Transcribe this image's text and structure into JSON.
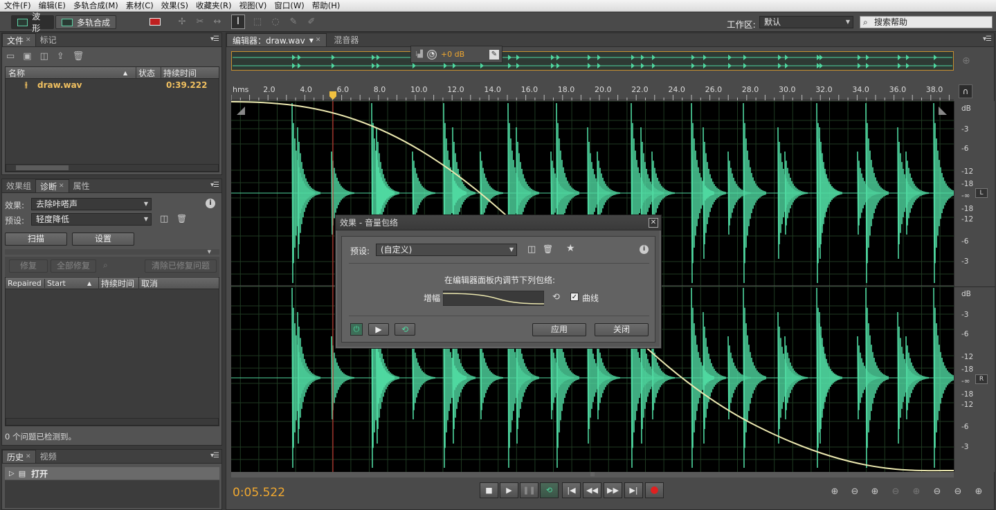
{
  "menu": [
    "文件(F)",
    "编辑(E)",
    "多轨合成(M)",
    "素材(C)",
    "效果(S)",
    "收藏夹(R)",
    "视图(V)",
    "窗口(W)",
    "帮助(H)"
  ],
  "toolbar": {
    "waveform": "波形",
    "multitrack": "多轨合成",
    "workspace_label": "工作区:",
    "workspace_value": "默认",
    "search_placeholder": "搜索帮助"
  },
  "files_panel": {
    "tabs": [
      "文件",
      "标记"
    ],
    "columns": [
      "名称",
      "状态",
      "持续时间"
    ],
    "file": {
      "name": "draw.wav",
      "duration": "0:39.222"
    }
  },
  "diag_panel": {
    "tabs": [
      "效果组",
      "诊断",
      "属性"
    ],
    "effect_label": "效果:",
    "effect_value": "去除咔嗒声",
    "preset_label": "预设:",
    "preset_value": "轻度降低",
    "scan": "扫描",
    "settings": "设置",
    "repair": "修复",
    "repair_all": "全部修复",
    "clear_repaired": "清除已修复问题",
    "columns": [
      "Repaired",
      "Start",
      "持续时间",
      "取消"
    ],
    "status": "0 个问题已检测到。"
  },
  "history_panel": {
    "tabs": [
      "历史",
      "视频"
    ],
    "item": "打开"
  },
  "editor": {
    "tabs": [
      "编辑器：draw.wav",
      "混音器"
    ],
    "hud_gain": "+0 dB",
    "ruler_start": "hms",
    "ruler": [
      "2.0",
      "4.0",
      "6.0",
      "8.0",
      "10.0",
      "12.0",
      "14.0",
      "16.0",
      "18.0",
      "20.0",
      "22.0",
      "24.0",
      "26.0",
      "28.0",
      "30.0",
      "32.0",
      "34.0",
      "36.0",
      "38.0"
    ],
    "db_scale": [
      "dB",
      "-3",
      "-6",
      "-12",
      "-18",
      "-∞",
      "-18",
      "-12",
      "-6",
      "-3"
    ],
    "ch_left": "L",
    "ch_right": "R",
    "time": "0:05.522"
  },
  "dialog": {
    "title": "效果 - 音量包络",
    "preset_label": "预设:",
    "preset_value": "(自定义)",
    "instruction": "在编辑器面板内调节下列包络:",
    "gain_label": "增幅",
    "curve_label": "曲线",
    "apply": "应用",
    "close": "关闭"
  },
  "colors": {
    "waveform": "#4fd8a0",
    "envelope": "#ece8b0",
    "playhead": "#e03030",
    "accent": "#f0a830"
  }
}
